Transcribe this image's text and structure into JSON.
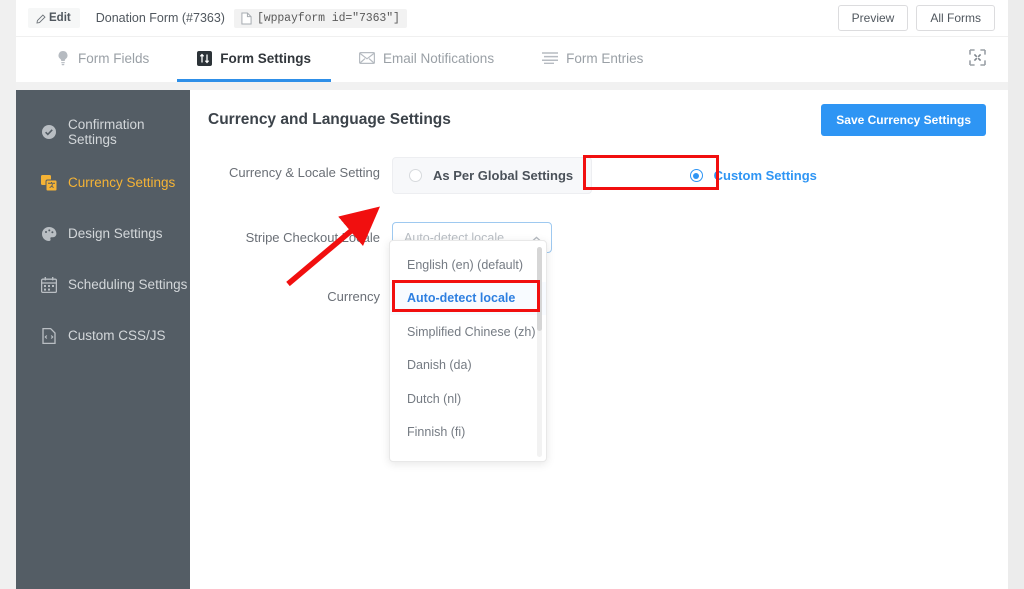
{
  "topbar": {
    "edit_label": "Edit",
    "form_title": "Donation Form (#7363)",
    "shortcode": "[wppayform id=\"7363\"]",
    "preview_label": "Preview",
    "all_forms_label": "All Forms"
  },
  "tabs": [
    {
      "label": "Form Fields",
      "icon": "lightbulb-icon",
      "active": false
    },
    {
      "label": "Form Settings",
      "icon": "sliders-icon",
      "active": true
    },
    {
      "label": "Email Notifications",
      "icon": "envelope-icon",
      "active": false
    },
    {
      "label": "Form Entries",
      "icon": "list-icon",
      "active": false
    }
  ],
  "expand_icon": "fullscreen-icon",
  "sidebar": {
    "items": [
      {
        "label": "Confirmation Settings",
        "icon": "check-circle-icon",
        "active": false
      },
      {
        "label": "Currency Settings",
        "icon": "translate-icon",
        "active": true
      },
      {
        "label": "Design Settings",
        "icon": "palette-icon",
        "active": false
      },
      {
        "label": "Scheduling Settings",
        "icon": "calendar-icon",
        "active": false
      },
      {
        "label": "Custom CSS/JS",
        "icon": "code-file-icon",
        "active": false
      }
    ]
  },
  "content": {
    "title": "Currency and Language Settings",
    "save_label": "Save Currency Settings",
    "rows": {
      "locale_setting": {
        "label": "Currency & Locale Setting",
        "option_global": "As Per Global Settings",
        "option_custom": "Custom Settings",
        "selected": "Custom Settings"
      },
      "stripe_locale": {
        "label": "Stripe Checkout Locale",
        "value": "Auto-detect locale",
        "placeholder": "Auto-detect locale"
      },
      "currency": {
        "label": "Currency"
      }
    },
    "dropdown": {
      "options": [
        {
          "label": "English (en) (default)",
          "selected": false
        },
        {
          "label": "Auto-detect locale",
          "selected": true
        },
        {
          "label": "Simplified Chinese (zh)",
          "selected": false
        },
        {
          "label": "Danish (da)",
          "selected": false
        },
        {
          "label": "Dutch (nl)",
          "selected": false
        },
        {
          "label": "Finnish (fi)",
          "selected": false
        }
      ]
    }
  },
  "colors": {
    "accent_blue": "#2e95f4",
    "sidebar_bg": "#545d65",
    "active_gold": "#f5b335",
    "annotation_red": "#f10f0f"
  }
}
